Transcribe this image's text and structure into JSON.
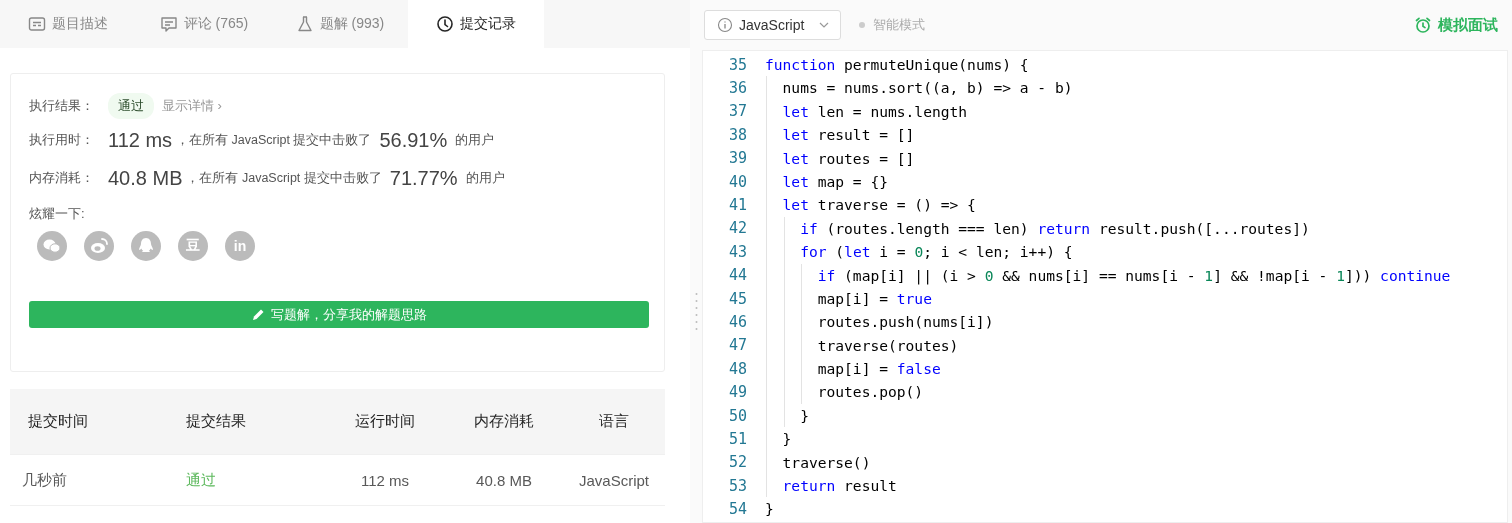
{
  "tabs": [
    {
      "label": "题目描述",
      "selected": false
    },
    {
      "label": "评论 (765)",
      "selected": false
    },
    {
      "label": "题解 (993)",
      "selected": false
    },
    {
      "label": "提交记录",
      "selected": true
    }
  ],
  "result_card": {
    "result": {
      "label": "执行结果：",
      "status": "通过",
      "details_link": "显示详情 ›"
    },
    "stats": [
      {
        "label": "执行用时：",
        "value": "112 ms",
        "text": "，在所有 JavaScript 提交中击败了",
        "percent": "56.91%",
        "suffix": "的用户"
      },
      {
        "label": "内存消耗：",
        "value": "40.8 MB",
        "text": "，在所有 JavaScript 提交中击败了",
        "percent": "71.77%",
        "suffix": "的用户"
      }
    ],
    "share_label": "炫耀一下:",
    "share_buttons": [
      {
        "kind": "wechat"
      },
      {
        "kind": "weibo"
      },
      {
        "kind": "qq"
      },
      {
        "kind": "text",
        "glyph": "豆"
      },
      {
        "kind": "text",
        "glyph": "in"
      }
    ],
    "write_button": "写题解，分享我的解题思路"
  },
  "table": {
    "columns": [
      "提交时间",
      "提交结果",
      "运行时间",
      "内存消耗",
      "语言"
    ],
    "rows": [
      {
        "cells": [
          "几秒前",
          "通过",
          "112 ms",
          "40.8 MB",
          "JavaScript"
        ]
      }
    ]
  },
  "editor_toolbar": {
    "language": "JavaScript",
    "smart_mode": {
      "label": "智能模式",
      "on": false
    },
    "interview_button": "模拟面试"
  },
  "code": [
    {
      "number": "35",
      "tokens": [
        {
          "kind": "keyword",
          "text": "function"
        },
        {
          "kind": "plain",
          "text": " permuteUnique(nums) {"
        }
      ]
    },
    {
      "number": "36",
      "tokens": [
        {
          "kind": "plain",
          "text": "  nums = nums.sort((a, b) => a - b)"
        }
      ]
    },
    {
      "number": "37",
      "tokens": [
        {
          "kind": "keyword",
          "text": "  let"
        },
        {
          "kind": "plain",
          "text": " len = nums.length"
        }
      ]
    },
    {
      "number": "38",
      "tokens": [
        {
          "kind": "keyword",
          "text": "  let"
        },
        {
          "kind": "plain",
          "text": " result = []"
        }
      ]
    },
    {
      "number": "39",
      "tokens": [
        {
          "kind": "keyword",
          "text": "  let"
        },
        {
          "kind": "plain",
          "text": " routes = []"
        }
      ]
    },
    {
      "number": "40",
      "tokens": [
        {
          "kind": "keyword",
          "text": "  let"
        },
        {
          "kind": "plain",
          "text": " map = {}"
        }
      ]
    },
    {
      "number": "41",
      "tokens": [
        {
          "kind": "keyword",
          "text": "  let"
        },
        {
          "kind": "plain",
          "text": " traverse = () => {"
        }
      ]
    },
    {
      "number": "42",
      "tokens": [
        {
          "kind": "keyword",
          "text": "    if"
        },
        {
          "kind": "plain",
          "text": " (routes.length === len) "
        },
        {
          "kind": "keyword",
          "text": "return"
        },
        {
          "kind": "plain",
          "text": " result.push([...routes])"
        }
      ]
    },
    {
      "number": "43",
      "tokens": [
        {
          "kind": "keyword",
          "text": "    for"
        },
        {
          "kind": "plain",
          "text": " ("
        },
        {
          "kind": "keyword",
          "text": "let"
        },
        {
          "kind": "plain",
          "text": " i = "
        },
        {
          "kind": "number",
          "text": "0"
        },
        {
          "kind": "plain",
          "text": "; i < len; i++) {"
        }
      ]
    },
    {
      "number": "44",
      "tokens": [
        {
          "kind": "keyword",
          "text": "      if"
        },
        {
          "kind": "plain",
          "text": " (map[i] || (i > "
        },
        {
          "kind": "number",
          "text": "0"
        },
        {
          "kind": "plain",
          "text": " && nums[i] == nums[i - "
        },
        {
          "kind": "number",
          "text": "1"
        },
        {
          "kind": "plain",
          "text": "] && !map[i - "
        },
        {
          "kind": "number",
          "text": "1"
        },
        {
          "kind": "plain",
          "text": "])) "
        },
        {
          "kind": "keyword",
          "text": "continue"
        }
      ]
    },
    {
      "number": "45",
      "tokens": [
        {
          "kind": "plain",
          "text": "      map[i] = "
        },
        {
          "kind": "keyword",
          "text": "true"
        }
      ]
    },
    {
      "number": "46",
      "tokens": [
        {
          "kind": "plain",
          "text": "      routes.push(nums[i])"
        }
      ]
    },
    {
      "number": "47",
      "tokens": [
        {
          "kind": "plain",
          "text": "      traverse(routes)"
        }
      ]
    },
    {
      "number": "48",
      "tokens": [
        {
          "kind": "plain",
          "text": "      map[i] = "
        },
        {
          "kind": "keyword",
          "text": "false"
        }
      ]
    },
    {
      "number": "49",
      "tokens": [
        {
          "kind": "plain",
          "text": "      routes.pop()"
        }
      ]
    },
    {
      "number": "50",
      "tokens": [
        {
          "kind": "plain",
          "text": "    }"
        }
      ]
    },
    {
      "number": "51",
      "tokens": [
        {
          "kind": "plain",
          "text": "  }"
        }
      ]
    },
    {
      "number": "52",
      "tokens": [
        {
          "kind": "plain",
          "text": "  traverse()"
        }
      ]
    },
    {
      "number": "53",
      "tokens": [
        {
          "kind": "keyword",
          "text": "  return"
        },
        {
          "kind": "plain",
          "text": " result"
        }
      ]
    },
    {
      "number": "54",
      "tokens": [
        {
          "kind": "plain",
          "text": "}"
        }
      ]
    }
  ]
}
